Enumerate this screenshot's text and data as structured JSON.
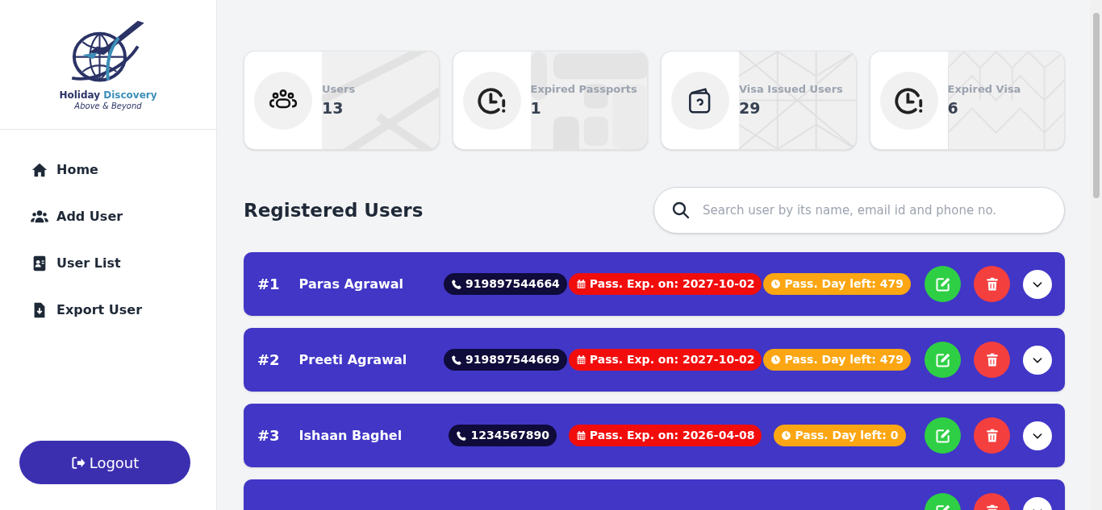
{
  "brand": {
    "name_part_1": "Holiday",
    "name_part_2": "Discovery",
    "tagline": "Above & Beyond"
  },
  "nav": [
    {
      "label": "Home"
    },
    {
      "label": "Add User"
    },
    {
      "label": "User List"
    },
    {
      "label": "Export User"
    }
  ],
  "logout": {
    "label": "Logout"
  },
  "stats": [
    {
      "label": "Users",
      "value": "13"
    },
    {
      "label": "Expired Passports",
      "value": "1"
    },
    {
      "label": "Visa Issued Users",
      "value": "29"
    },
    {
      "label": "Expired Visa",
      "value": "6"
    }
  ],
  "section_title": "Registered Users",
  "search": {
    "placeholder": "Search user by its name, email id and phone no."
  },
  "users": [
    {
      "kind": "full",
      "index": "#1",
      "name": "Paras Agrawal",
      "phone": "919897544664",
      "pass_exp": "Pass. Exp. on: 2027-10-02",
      "days_left": "Pass. Day left: 479"
    },
    {
      "kind": "full",
      "index": "#2",
      "name": "Preeti Agrawal",
      "phone": "919897544669",
      "pass_exp": "Pass. Exp. on: 2027-10-02",
      "days_left": "Pass. Day left: 479"
    },
    {
      "kind": "full",
      "index": "#3",
      "name": "Ishaan Baghel",
      "phone": "1234567890",
      "pass_exp": "Pass. Exp. on: 2026-04-08",
      "days_left": "Pass. Day left: 0"
    },
    {
      "kind": "cut_off"
    }
  ]
}
